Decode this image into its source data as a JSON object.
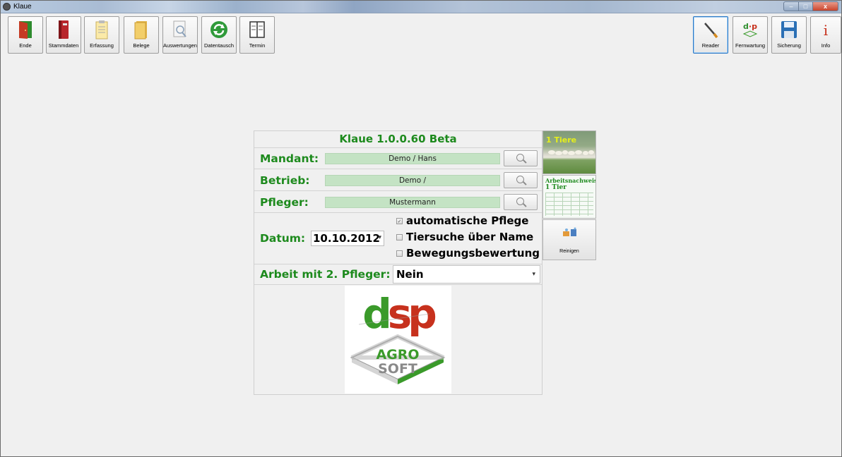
{
  "window": {
    "title": "Klaue",
    "controls": {
      "minimize": "–",
      "maximize": "□",
      "close": "x"
    }
  },
  "toolbar": {
    "left": [
      {
        "id": "ende",
        "label": "Ende",
        "icon": "exit-door-icon"
      },
      {
        "id": "stammdaten",
        "label": "Stammdaten",
        "icon": "binder-icon"
      },
      {
        "id": "erfassung",
        "label": "Erfassung",
        "icon": "clipboard-icon"
      },
      {
        "id": "belege",
        "label": "Belege",
        "icon": "folder-icon"
      },
      {
        "id": "auswertungen",
        "label": "Auswertungen",
        "icon": "magnifier-document-icon"
      },
      {
        "id": "datentausch",
        "label": "Datentausch",
        "icon": "sync-arrows-icon"
      },
      {
        "id": "termin",
        "label": "Termin",
        "icon": "calendar-book-icon"
      }
    ],
    "right": [
      {
        "id": "reader",
        "label": "Reader",
        "icon": "reader-wand-icon"
      },
      {
        "id": "fernwartung",
        "label": "Fernwartung",
        "icon": "dsp-logo-icon"
      },
      {
        "id": "sicherung",
        "label": "Sicherung",
        "icon": "floppy-disk-icon"
      },
      {
        "id": "info",
        "label": "Info",
        "icon": "info-icon"
      }
    ]
  },
  "panel": {
    "title": "Klaue 1.0.0.60 Beta",
    "mandant": {
      "label": "Mandant:",
      "value": "Demo / Hans"
    },
    "betrieb": {
      "label": "Betrieb:",
      "value": "Demo /"
    },
    "pfleger": {
      "label": "Pfleger:",
      "value": "Mustermann"
    },
    "datum": {
      "label": "Datum:",
      "value": "10.10.2012"
    },
    "options": [
      {
        "label": "automatische Pflege",
        "checked": true
      },
      {
        "label": "Tiersuche über Name",
        "checked": false
      },
      {
        "label": "Bewegungsbewertung",
        "checked": false
      }
    ],
    "pfleger2": {
      "label": "Arbeit mit 2. Pfleger:",
      "value": "Nein"
    }
  },
  "logo": {
    "top": "dsp",
    "line1": "AGRO",
    "line2": "SOFT"
  },
  "tiles": {
    "tiere": "1 Tiere",
    "arbeitsnachweis_title": "Arbeitsnachweis",
    "arbeitsnachweis_count": "1 Tier",
    "reinigen": "Reinigen"
  },
  "colors": {
    "brand_green": "#1d8a1d",
    "field_green": "#c4e3c4",
    "dsp_red": "#c7311d",
    "logo_green": "#3a9a2a"
  }
}
